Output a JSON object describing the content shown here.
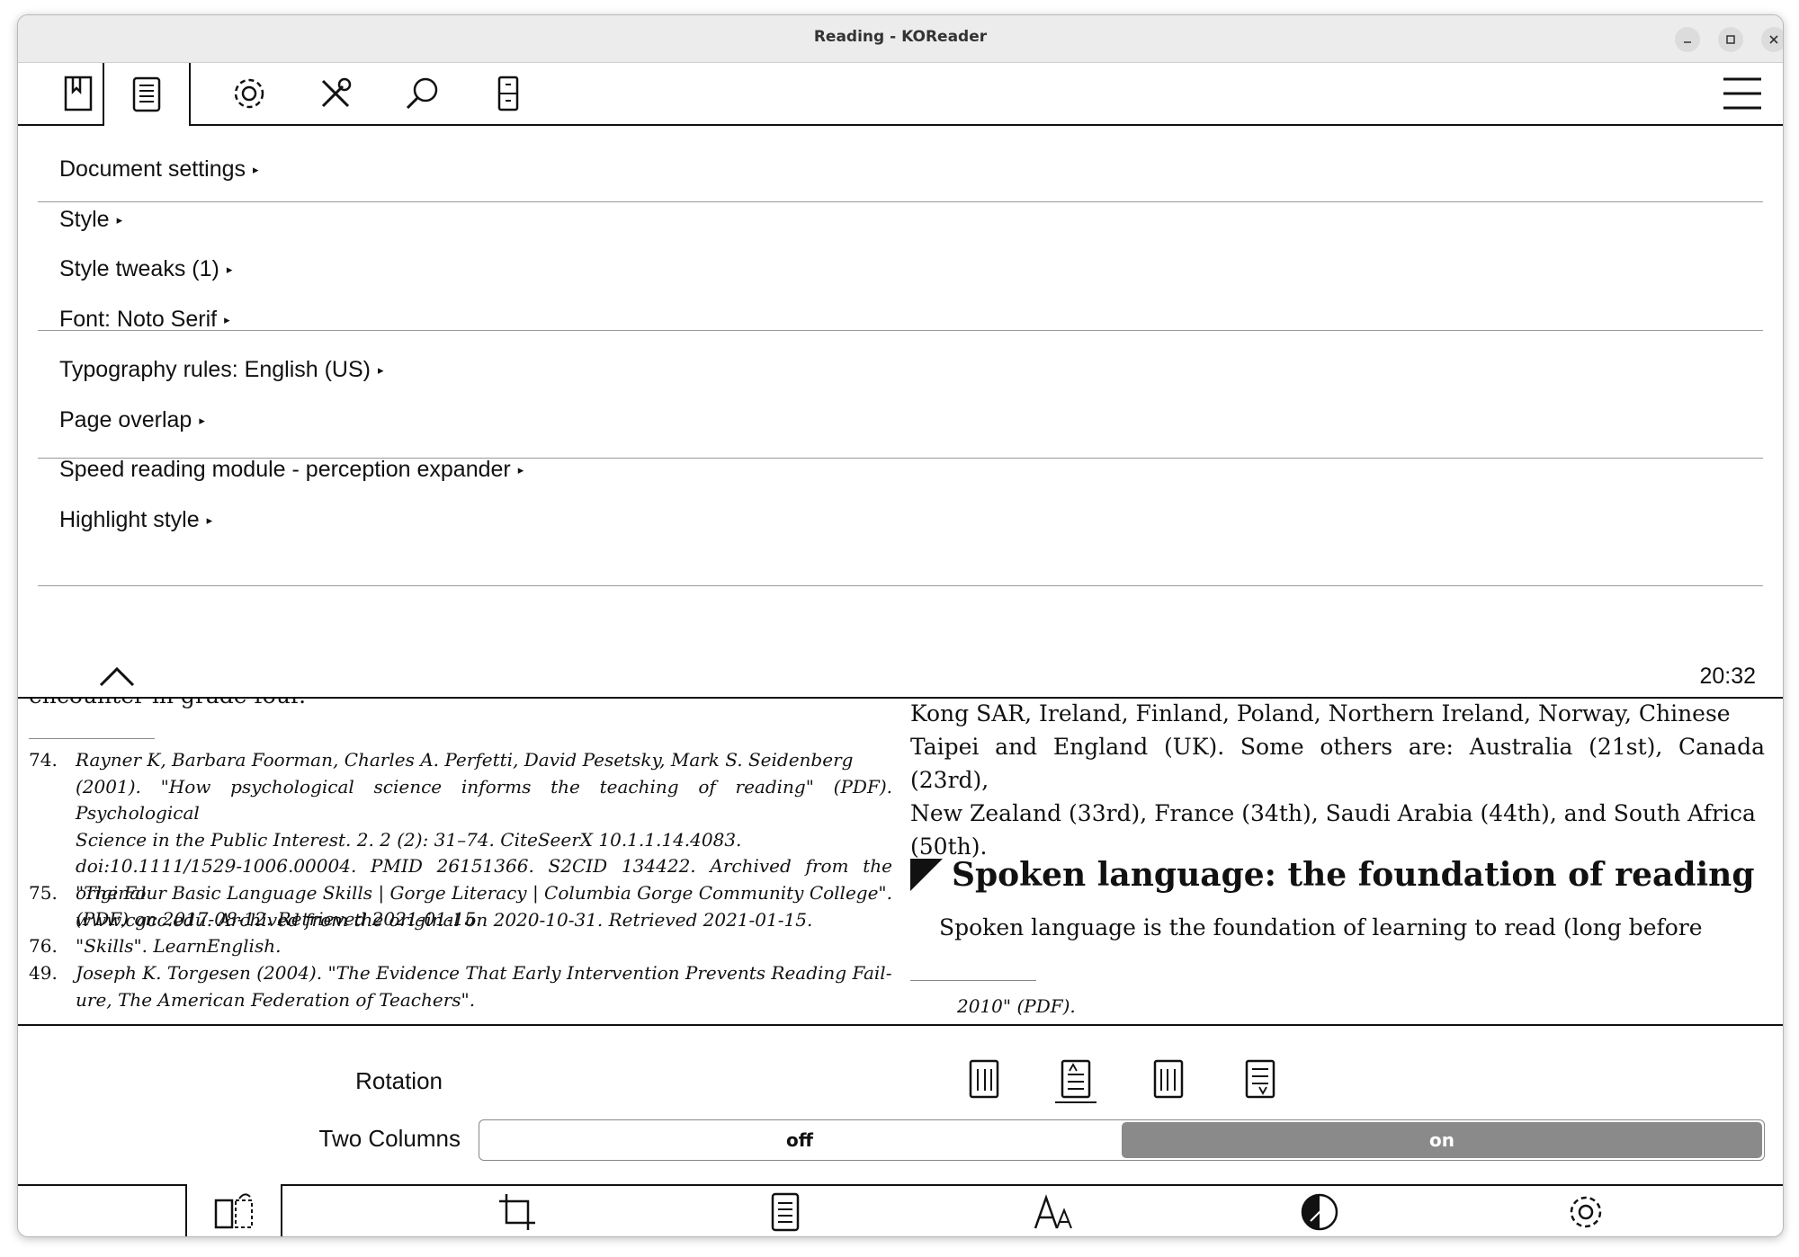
{
  "window": {
    "title": "Reading - KOReader"
  },
  "top_tabs": [
    {
      "name": "bookmark",
      "icon": "bookmark-icon"
    },
    {
      "name": "document",
      "icon": "document-icon",
      "active": true
    },
    {
      "name": "settings",
      "icon": "gear-icon"
    },
    {
      "name": "tools",
      "icon": "tools-icon"
    },
    {
      "name": "search",
      "icon": "search-icon"
    },
    {
      "name": "device",
      "icon": "cabinet-icon"
    }
  ],
  "menu": {
    "items": [
      {
        "label": "Document settings"
      },
      {
        "label": "Style"
      },
      {
        "label": "Style tweaks (1)"
      },
      {
        "label": "Font: Noto Serif"
      },
      {
        "label": "Typography rules: English (US)"
      },
      {
        "label": "Page overlap"
      },
      {
        "label": "Speed reading module - perception expander"
      },
      {
        "label": "Highlight style"
      }
    ],
    "arrow": "▸",
    "clock": "20:32"
  },
  "document": {
    "cut_text": "encounter in grade four.",
    "footnotes": [
      {
        "num": "74.",
        "lines": [
          "Rayner K, Barbara Foorman, Charles A. Perfetti, David Pesetsky, Mark S. Seidenberg",
          "(2001). \"How psychological science informs the teaching of reading\" (PDF). Psychological",
          "Science in the Public Interest. 2. 2 (2): 31–74. CiteSeerX 10.1.1.14.4083.",
          "doi:10.1111/1529-1006.00004. PMID 26151366. S2CID 134422. Archived from the original",
          "(PDF) on 2017-08-12. Retrieved 2021-01-15."
        ]
      },
      {
        "num": "75.",
        "lines": [
          "\"The Four Basic Language Skills | Gorge Literacy | Columbia Gorge Community College\".",
          "www.cgcc.edu. Archived from the original on 2020-10-31. Retrieved 2021-01-15."
        ]
      },
      {
        "num": "76.",
        "lines": [
          "\"Skills\". LearnEnglish."
        ]
      },
      {
        "num": "49.",
        "lines": [
          "Joseph K. Torgesen (2004). \"The Evidence That Early Intervention Prevents Reading Fail-",
          "ure, The American Federation of Teachers\"."
        ]
      }
    ],
    "right_lines": [
      "Kong SAR, Ireland, Finland, Poland, Northern Ireland, Norway, Chinese",
      "Taipei and England (UK). Some others are: Australia (21st), Canada (23rd),",
      "New Zealand (33rd), France (34th), Saudi Arabia (44th), and South Africa",
      "(50th)."
    ],
    "heading": "Spoken language: the foundation of reading",
    "para": "Spoken language is the foundation of learning to read (long before",
    "right_footnote": "2010\" (PDF)."
  },
  "config": {
    "rotation_label": "Rotation",
    "two_columns_label": "Two Columns",
    "toggle_off": "off",
    "toggle_on": "on"
  },
  "bottom_tabs": [
    {
      "icon": "page-flip-icon",
      "active": true
    },
    {
      "icon": "crop-icon"
    },
    {
      "icon": "page-layout-icon"
    },
    {
      "icon": "font-size-icon"
    },
    {
      "icon": "contrast-icon"
    },
    {
      "icon": "gear-icon"
    }
  ]
}
